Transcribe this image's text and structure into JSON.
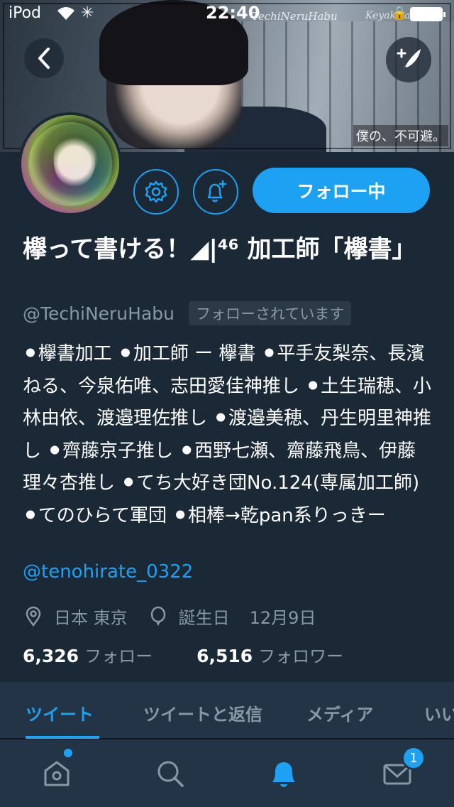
{
  "status_bar": {
    "carrier": "iPod",
    "time": "22:40"
  },
  "header": {
    "watermark_left": "TechiNeruHabu",
    "watermark_right": "Keyakizaka",
    "banner_caption": "僕の、不可避。"
  },
  "profile": {
    "display_name": "欅って書ける！◢|⁴⁶ 加工師「欅書」",
    "handle": "@TechiNeruHabu",
    "follows_you": "フォローされています",
    "follow_button": "フォロー中",
    "bio": "⚫︎欅書加工 ⚫︎加工師 ー 欅書 ⚫︎平手友梨奈、長濱ねる、今泉佑唯、志田愛佳神推し ⚫︎土生瑞穂、小林由依、渡邉理佐推し ⚫︎渡邉美穂、丹生明里神推し ⚫︎齊藤京子推し ⚫︎西野七瀬、齋藤飛鳥、伊藤理々杏推し ⚫︎てち大好き団No.124(専属加工師) ⚫︎てのひらて軍団 ⚫︎相棒→乾pan系りっきー",
    "bio_link": "@tenohirate_0322",
    "location": "日本 東京",
    "birthday_label": "誕生日",
    "birthday_value": "12月9日",
    "following_count": "6,326",
    "following_label": "フォロー",
    "followers_count": "6,516",
    "followers_label": "フォロワー"
  },
  "tabs": [
    {
      "label": "ツイート",
      "active": true
    },
    {
      "label": "ツイートと返信",
      "active": false
    },
    {
      "label": "メディア",
      "active": false
    },
    {
      "label": "いい",
      "active": false
    }
  ],
  "bottom_nav": {
    "items": [
      "home-icon",
      "search-icon",
      "notifications-icon",
      "messages-icon"
    ],
    "messages_badge": "1"
  },
  "colors": {
    "background": "#1b2836",
    "accent": "#1da1f2",
    "secondary_text": "#8899a6",
    "bar": "#243447"
  }
}
